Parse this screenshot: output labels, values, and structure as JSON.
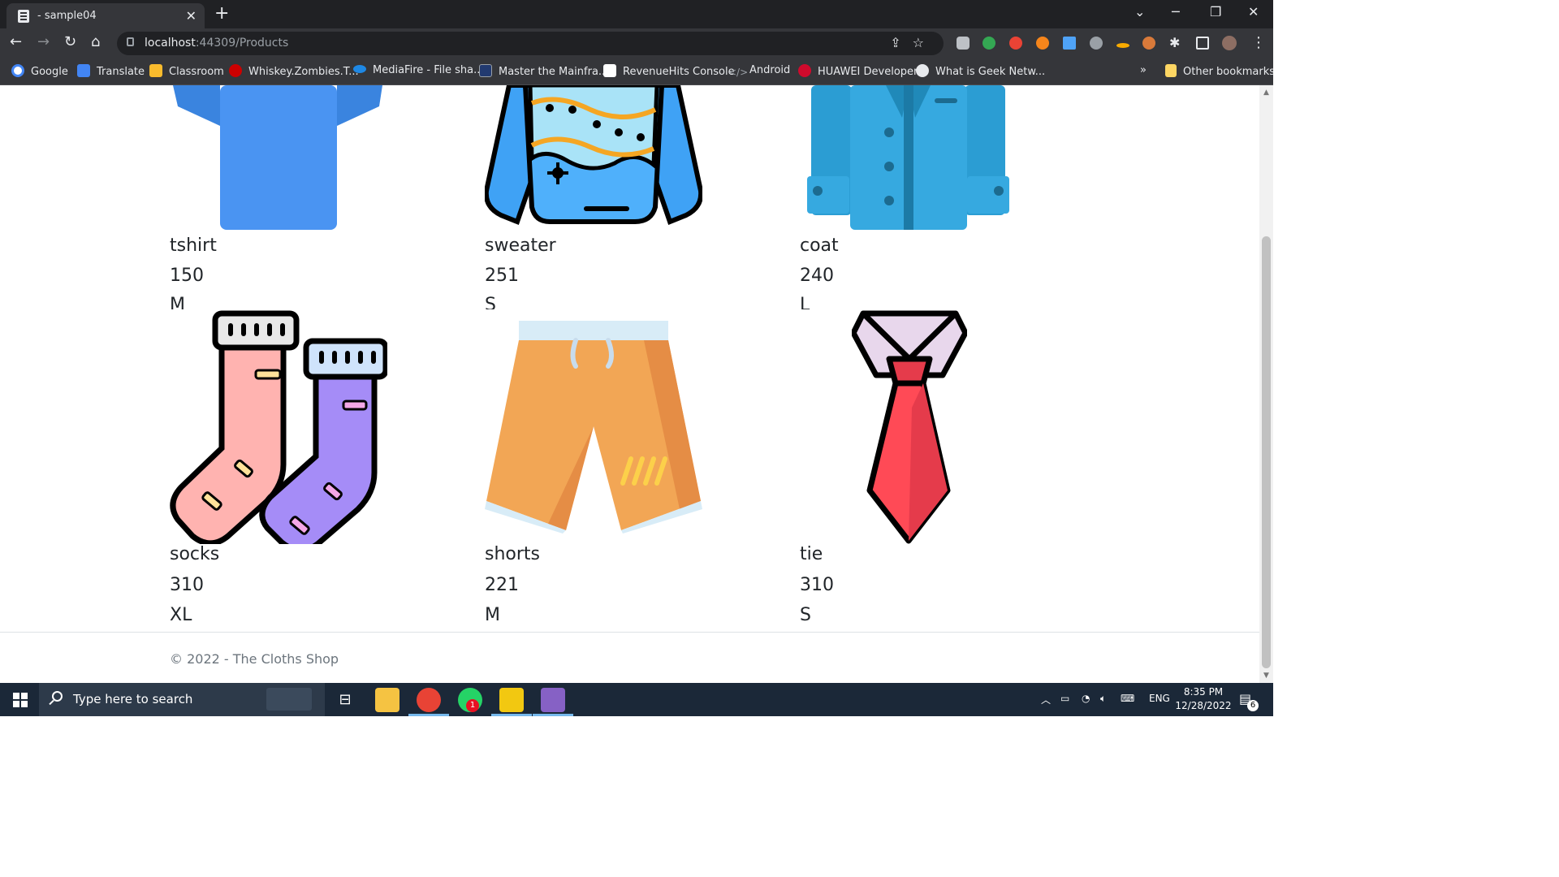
{
  "browser": {
    "tab_title": "- sample04",
    "url_host": "localhost",
    "url_path": ":44309/Products",
    "bookmarks": [
      {
        "label": "Google",
        "color": "#ffffff"
      },
      {
        "label": "Translate",
        "color": "#4285f4"
      },
      {
        "label": "Classroom",
        "color": "#f9bb2d"
      },
      {
        "label": "Whiskey.Zombies.T...",
        "color": "#cc0000"
      },
      {
        "label": "MediaFire - File sha...",
        "color": "#1e88e5"
      },
      {
        "label": "Master the Mainfra...",
        "color": "#223a70"
      },
      {
        "label": "RevenueHits Console",
        "color": "#ffffff"
      },
      {
        "label": "Android",
        "color": "#9aa0a6"
      },
      {
        "label": "HUAWEI Developer",
        "color": "#cf0a2c"
      },
      {
        "label": "What is Geek Netw...",
        "color": "#e8eaed"
      }
    ],
    "overflow_label": "»",
    "other_bookmarks": "Other bookmarks"
  },
  "products": [
    {
      "name": "tshirt",
      "price": "150",
      "size": "M",
      "icon": "tshirt-image"
    },
    {
      "name": "sweater",
      "price": "251",
      "size": "S",
      "icon": "sweater-image"
    },
    {
      "name": "coat",
      "price": "240",
      "size": "L",
      "icon": "coat-image"
    },
    {
      "name": "socks",
      "price": "310",
      "size": "XL",
      "icon": "socks-image"
    },
    {
      "name": "shorts",
      "price": "221",
      "size": "M",
      "icon": "shorts-image"
    },
    {
      "name": "tie",
      "price": "310",
      "size": "S",
      "icon": "tie-image"
    }
  ],
  "footer": {
    "text": "© 2022 - The Cloths Shop"
  },
  "taskbar": {
    "search_placeholder": "Type here to search",
    "language": "ENG",
    "time": "8:35 PM",
    "date": "12/28/2022",
    "notification_count": "6",
    "whatsapp_badge": "1"
  }
}
